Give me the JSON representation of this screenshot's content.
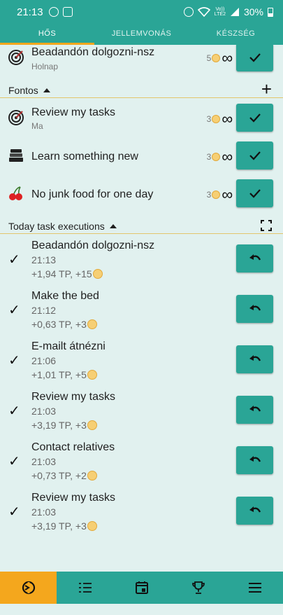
{
  "status_bar": {
    "time": "21:13",
    "network": "Vo))\nLTE2",
    "battery": "30%"
  },
  "tabs": [
    {
      "label": "HŐS",
      "active": true
    },
    {
      "label": "JELLEMVONÁS",
      "active": false
    },
    {
      "label": "KÉSZSÉG",
      "active": false
    }
  ],
  "top_task": {
    "title": "Beadandón dolgozni-nsz",
    "subtitle": "Holnap",
    "reward": "5",
    "icon": "target-icon"
  },
  "section_fontos": {
    "label": "Fontos"
  },
  "tasks": [
    {
      "title": "Review my tasks",
      "subtitle": "Ma",
      "reward": "3",
      "icon": "target-icon"
    },
    {
      "title": "Learn something new",
      "subtitle": "",
      "reward": "3",
      "icon": "books-icon"
    },
    {
      "title": "No junk food for one day",
      "subtitle": "",
      "reward": "3",
      "icon": "cherries-icon"
    }
  ],
  "section_executions": {
    "label": "Today task executions"
  },
  "executions": [
    {
      "title": "Beadandón dolgozni-nsz",
      "time": "21:13",
      "gain": "+1,94 TP, +15"
    },
    {
      "title": "Make the bed",
      "time": "21:12",
      "gain": "+0,63 TP, +3"
    },
    {
      "title": "E-mailt átnézni",
      "time": "21:06",
      "gain": "+1,01 TP, +5"
    },
    {
      "title": "Review my tasks",
      "time": "21:03",
      "gain": "+3,19 TP, +3"
    },
    {
      "title": "Contact relatives",
      "time": "21:03",
      "gain": "+0,73 TP, +2"
    },
    {
      "title": "Review my tasks",
      "time": "21:03",
      "gain": "+3,19 TP, +3"
    }
  ],
  "colors": {
    "primary": "#2aa596",
    "accent": "#f4a71d",
    "background": "#e1f1ef"
  },
  "bottom_nav": [
    "hero-icon",
    "list-icon",
    "calendar-icon",
    "trophy-icon",
    "menu-icon"
  ]
}
